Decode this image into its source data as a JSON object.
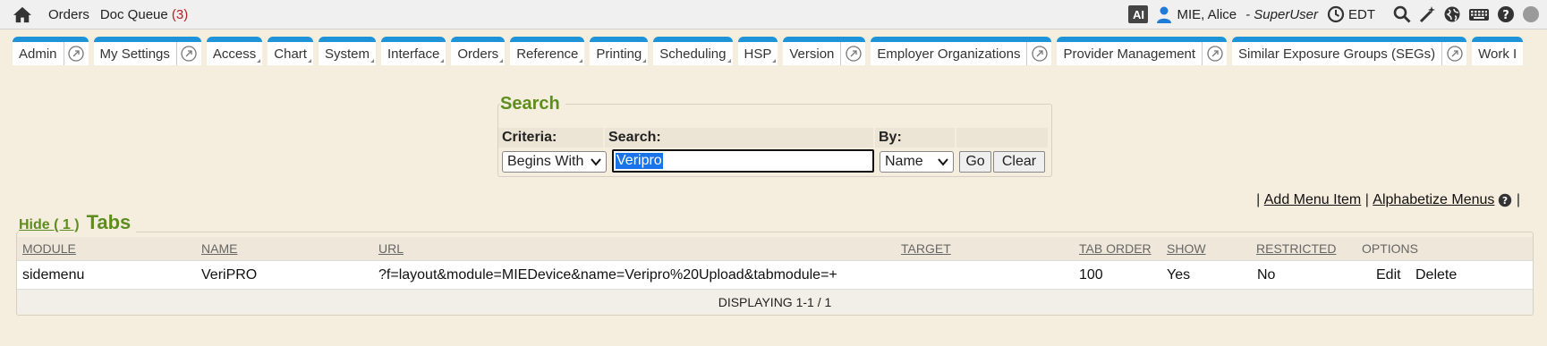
{
  "topbar": {
    "links": [
      {
        "label": "Orders"
      },
      {
        "label": "Doc Queue",
        "count": "(3)"
      }
    ],
    "ai_badge": "AI",
    "user_name": "MIE, Alice",
    "role": "- SuperUser",
    "timezone": "EDT",
    "icons": [
      "search-icon",
      "magic-wand-icon",
      "globe-icon",
      "keyboard-icon",
      "help-icon",
      "status-dot-icon"
    ]
  },
  "tabs": [
    {
      "label": "Admin",
      "ext": true,
      "dd": false
    },
    {
      "label": "My Settings",
      "ext": true,
      "dd": false
    },
    {
      "label": "Access",
      "ext": false,
      "dd": true
    },
    {
      "label": "Chart",
      "ext": false,
      "dd": true
    },
    {
      "label": "System",
      "ext": false,
      "dd": true
    },
    {
      "label": "Interface",
      "ext": false,
      "dd": true
    },
    {
      "label": "Orders",
      "ext": false,
      "dd": true
    },
    {
      "label": "Reference",
      "ext": false,
      "dd": true
    },
    {
      "label": "Printing",
      "ext": false,
      "dd": true
    },
    {
      "label": "Scheduling",
      "ext": false,
      "dd": true
    },
    {
      "label": "HSP",
      "ext": false,
      "dd": true
    },
    {
      "label": "Version",
      "ext": true,
      "dd": false
    },
    {
      "label": "Employer Organizations",
      "ext": true,
      "dd": false
    },
    {
      "label": "Provider Management",
      "ext": true,
      "dd": false
    },
    {
      "label": "Similar Exposure Groups (SEGs)",
      "ext": true,
      "dd": false
    },
    {
      "label": "Work I",
      "ext": false,
      "dd": false
    }
  ],
  "search": {
    "legend": "Search",
    "criteria_label": "Criteria:",
    "search_label": "Search:",
    "by_label": "By:",
    "criteria_value": "Begins With",
    "search_value": "Veripro",
    "by_value": "Name",
    "go_label": "Go",
    "clear_label": "Clear"
  },
  "menu_links": {
    "add": "Add Menu Item",
    "alphabetize": "Alphabetize Menus"
  },
  "tabs_section": {
    "hide_label": "Hide ( 1 )",
    "heading": "Tabs",
    "columns": [
      "MODULE",
      "NAME",
      "URL",
      "TARGET",
      "TAB ORDER",
      "SHOW",
      "RESTRICTED",
      "OPTIONS"
    ],
    "rows": [
      {
        "module": "sidemenu",
        "name": "VeriPRO",
        "url": "?f=layout&module=MIEDevice&name=Veripro%20Upload&tabmodule=+",
        "target": "",
        "tab_order": "100",
        "show": "Yes",
        "restricted": "No",
        "edit": "Edit",
        "delete": "Delete"
      }
    ],
    "footer": "DISPLAYING 1-1 / 1"
  }
}
